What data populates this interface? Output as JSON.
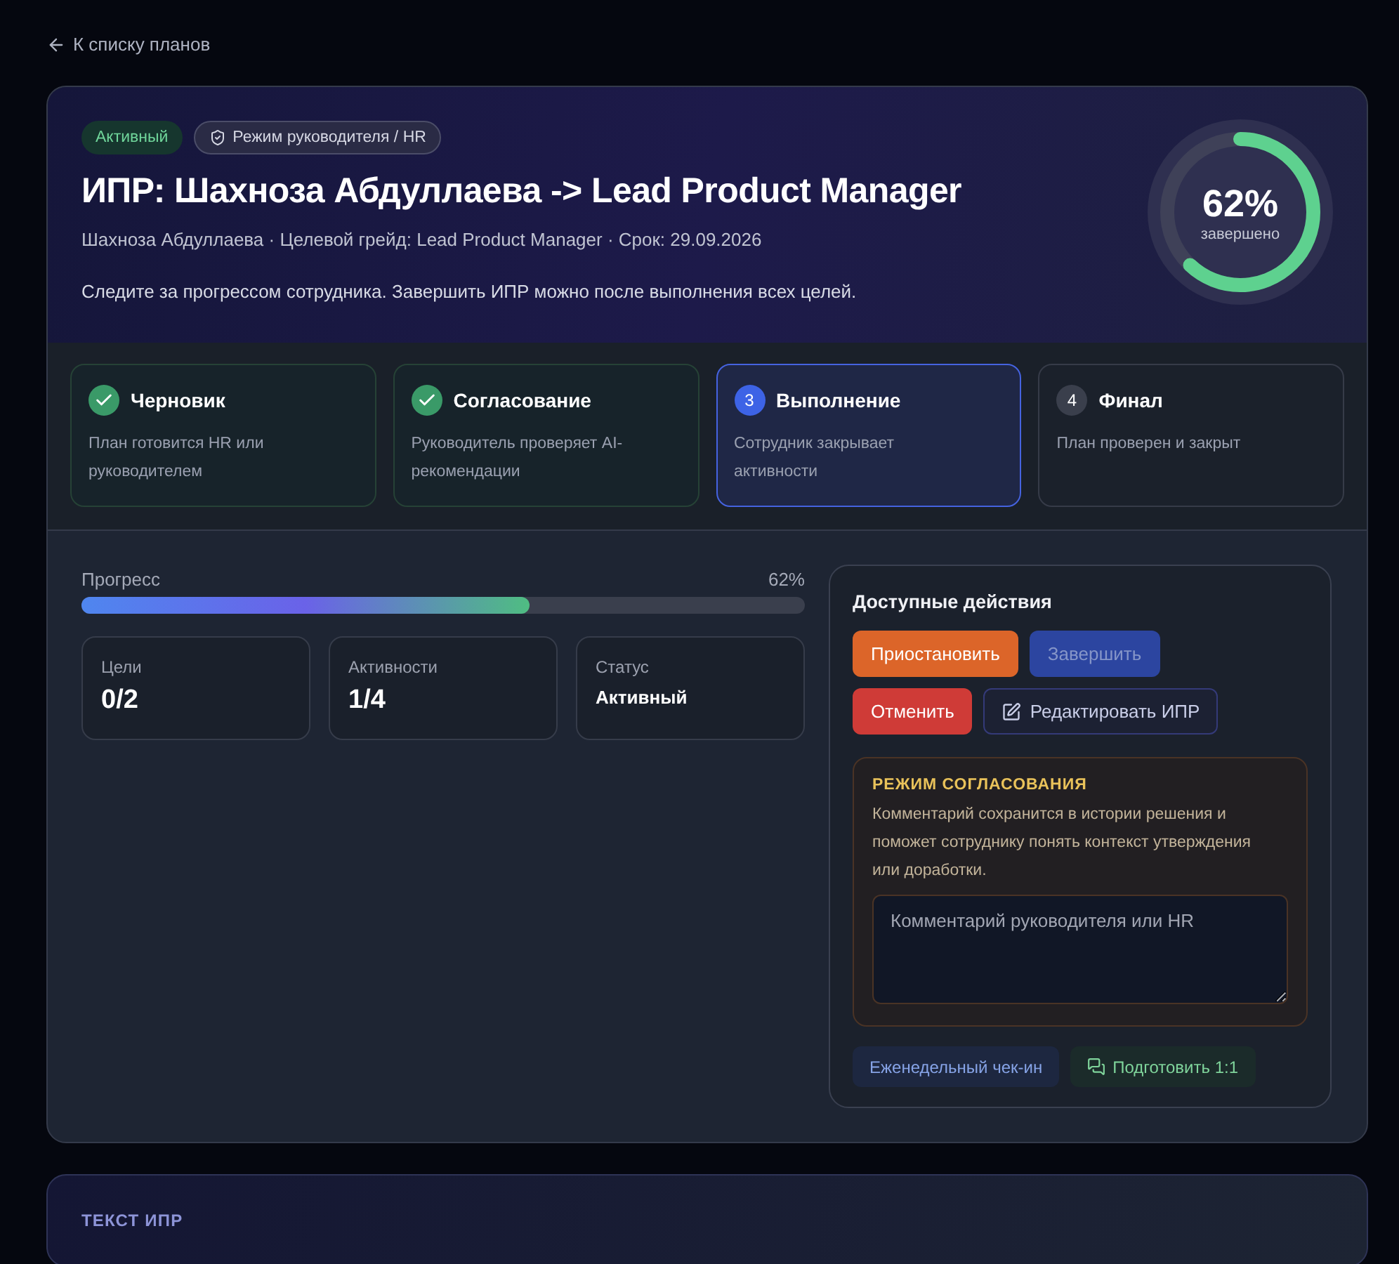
{
  "back_link": "К списку планов",
  "header": {
    "badges": [
      {
        "kind": "status",
        "label": "Активный"
      },
      {
        "kind": "mode",
        "label": "Режим руководителя / HR"
      }
    ],
    "title": "ИПР: Шахноза Абдуллаева -> Lead Product Manager",
    "meta": "Шахноза Абдуллаева · Целевой грейд: Lead Product Manager · Срок: 29.09.2026",
    "hint": "Следите за прогрессом сотрудника. Завершить ИПР можно после выполнения всех целей.",
    "ring": {
      "value": "62%",
      "caption": "завершено",
      "level": 0.62
    }
  },
  "steps": [
    {
      "title": "Черновик",
      "text": "План готовится HR или руководителем",
      "done": true,
      "current": false
    },
    {
      "title": "Согласование",
      "text": "Руководитель проверяет AI-рекомендации",
      "done": true,
      "current": false
    },
    {
      "marker": "3",
      "title": "Выполнение",
      "text": "Сотрудник закрывает активности",
      "done": false,
      "current": true
    },
    {
      "marker": "4",
      "title": "Финал",
      "text": "План проверен и закрыт",
      "done": false,
      "current": false
    }
  ],
  "progress": {
    "label": "Прогресс",
    "reading": "62%",
    "level": 0.62
  },
  "stats": [
    {
      "label": "Цели",
      "value": "0/2",
      "kind": "number"
    },
    {
      "label": "Активности",
      "value": "1/4",
      "kind": "number"
    },
    {
      "label": "Статус",
      "value": "Активный",
      "kind": "text"
    }
  ],
  "actions": {
    "title": "Доступные действия",
    "buttons": [
      {
        "label": "Приостановить",
        "kind": "warning",
        "disabled": false
      },
      {
        "label": "Завершить",
        "kind": "primary",
        "disabled": true
      },
      {
        "label": "Отменить",
        "kind": "danger",
        "disabled": false
      },
      {
        "label": "Редактировать ИПР",
        "kind": "outline",
        "disabled": false
      }
    ],
    "approval": {
      "title": "РЕЖИМ СОГЛАСОВАНИЯ",
      "text": "Комментарий сохранится в истории решения и поможет сотруднику понять контекст утверждения или доработки.",
      "placeholder": "Комментарий руководителя или HR"
    },
    "chips": [
      {
        "label": "Еженедельный чек-ин",
        "kind": "info"
      },
      {
        "label": "Подготовить 1:1",
        "kind": "chat"
      }
    ]
  },
  "next_section": {
    "title": "ТЕКСТ ИПР"
  }
}
